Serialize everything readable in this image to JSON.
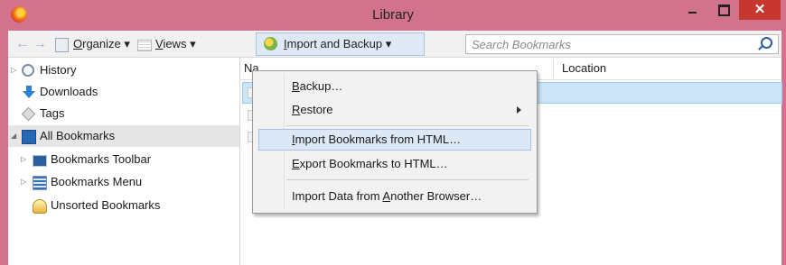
{
  "window": {
    "title": "Library",
    "controls": {
      "minimize": "–",
      "maximize": "□",
      "close": "✕"
    },
    "accent": "#d2738d",
    "close_color": "#c7372f"
  },
  "toolbar": {
    "back_icon": "←",
    "forward_icon": "→",
    "organize": {
      "pre": "",
      "accel": "O",
      "post": "rganize",
      "arrow": " ▾"
    },
    "views": {
      "pre": "",
      "accel": "V",
      "post": "iews",
      "arrow": " ▾"
    },
    "import_backup": {
      "pre": "",
      "accel": "I",
      "post": "mport and Backup",
      "arrow": " ▾"
    },
    "search_placeholder": "Search Bookmarks"
  },
  "sidebar": {
    "items": [
      {
        "label": "History",
        "icon": "history-icon",
        "twisty": "▷"
      },
      {
        "label": "Downloads",
        "icon": "downloads-icon",
        "twisty": ""
      },
      {
        "label": "Tags",
        "icon": "tags-icon",
        "twisty": ""
      },
      {
        "label": "All Bookmarks",
        "icon": "all-bookmarks-icon",
        "twisty": "◢",
        "selected": true
      },
      {
        "label": "Bookmarks Toolbar",
        "icon": "bookmarks-toolbar-icon",
        "twisty": "▷"
      },
      {
        "label": "Bookmarks Menu",
        "icon": "bookmarks-menu-icon",
        "twisty": "▷"
      },
      {
        "label": "Unsorted Bookmarks",
        "icon": "unsorted-bookmarks-icon",
        "twisty": ""
      }
    ]
  },
  "content": {
    "columns": {
      "name": "Na",
      "location": "Location"
    }
  },
  "menu": {
    "items": [
      {
        "pre": "",
        "accel": "B",
        "post": "ackup…",
        "has_submenu": false,
        "highlighted": false
      },
      {
        "pre": "",
        "accel": "R",
        "post": "estore",
        "has_submenu": true,
        "highlighted": false
      },
      {
        "pre": "",
        "accel": "I",
        "post": "mport Bookmarks from HTML…",
        "has_submenu": false,
        "highlighted": true
      },
      {
        "pre": "",
        "accel": "E",
        "post": "xport Bookmarks to HTML…",
        "has_submenu": false,
        "highlighted": false
      },
      {
        "pre": "Import Data from ",
        "accel": "A",
        "post": "nother Browser…",
        "has_submenu": false,
        "highlighted": false
      }
    ]
  }
}
